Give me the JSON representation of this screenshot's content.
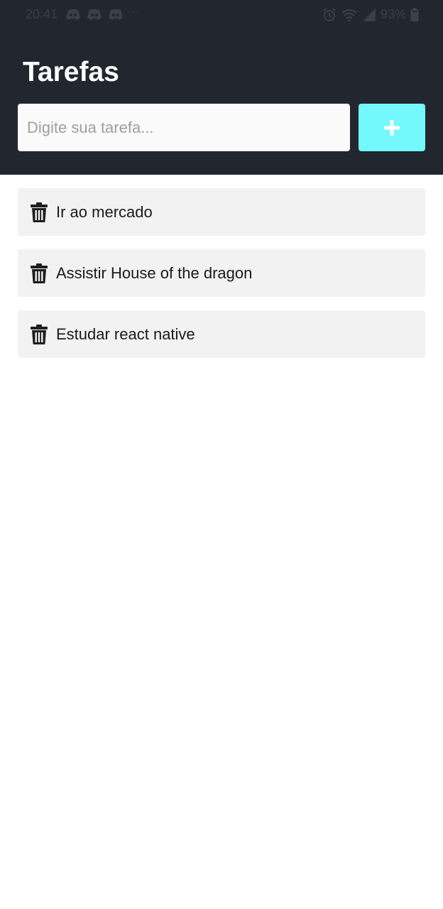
{
  "status_bar": {
    "time": "20:41",
    "dots": "···",
    "battery": "93%",
    "icons": [
      "discord-icon",
      "discord-icon",
      "discord-icon",
      "alarm-icon",
      "wifi-icon",
      "signal-icon",
      "battery-icon"
    ]
  },
  "header": {
    "title": "Tarefas",
    "background": "#22262e"
  },
  "task_input": {
    "value": "",
    "placeholder": "Digite sua tarefa..."
  },
  "add_button": {
    "icon": "plus-icon",
    "color": "#75f7fe"
  },
  "tasks": [
    {
      "label": "Ir ao mercado",
      "icon": "trash-icon"
    },
    {
      "label": "Assistir House of the dragon",
      "icon": "trash-icon"
    },
    {
      "label": "Estudar react native",
      "icon": "trash-icon"
    }
  ]
}
